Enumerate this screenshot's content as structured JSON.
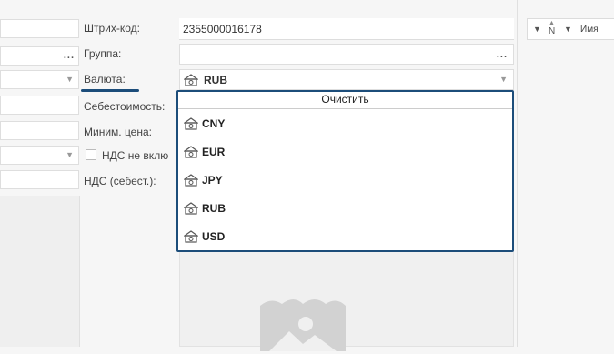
{
  "labels": {
    "barcode": "Штрих-код:",
    "group": "Группа:",
    "currency": "Валюта:",
    "cost": "Себестоимость:",
    "min_price": "Миним. цена:",
    "vat_excluded": "НДС не вклю",
    "vat_cost": "НДС (себест.):"
  },
  "fields": {
    "barcode_value": "2355000016178",
    "group_value": "",
    "currency_value": "RUB"
  },
  "dropdown": {
    "clear_label": "Очистить",
    "options": [
      "CNY",
      "EUR",
      "JPY",
      "RUB",
      "USD"
    ]
  },
  "right_panel": {
    "col_n": "N",
    "col_name": "Имя"
  },
  "icons": {
    "currency": "banknote-icon",
    "filter": "filter-icon",
    "image_placeholder": "image-placeholder-icon"
  },
  "colors": {
    "accent": "#1c4d7a"
  }
}
